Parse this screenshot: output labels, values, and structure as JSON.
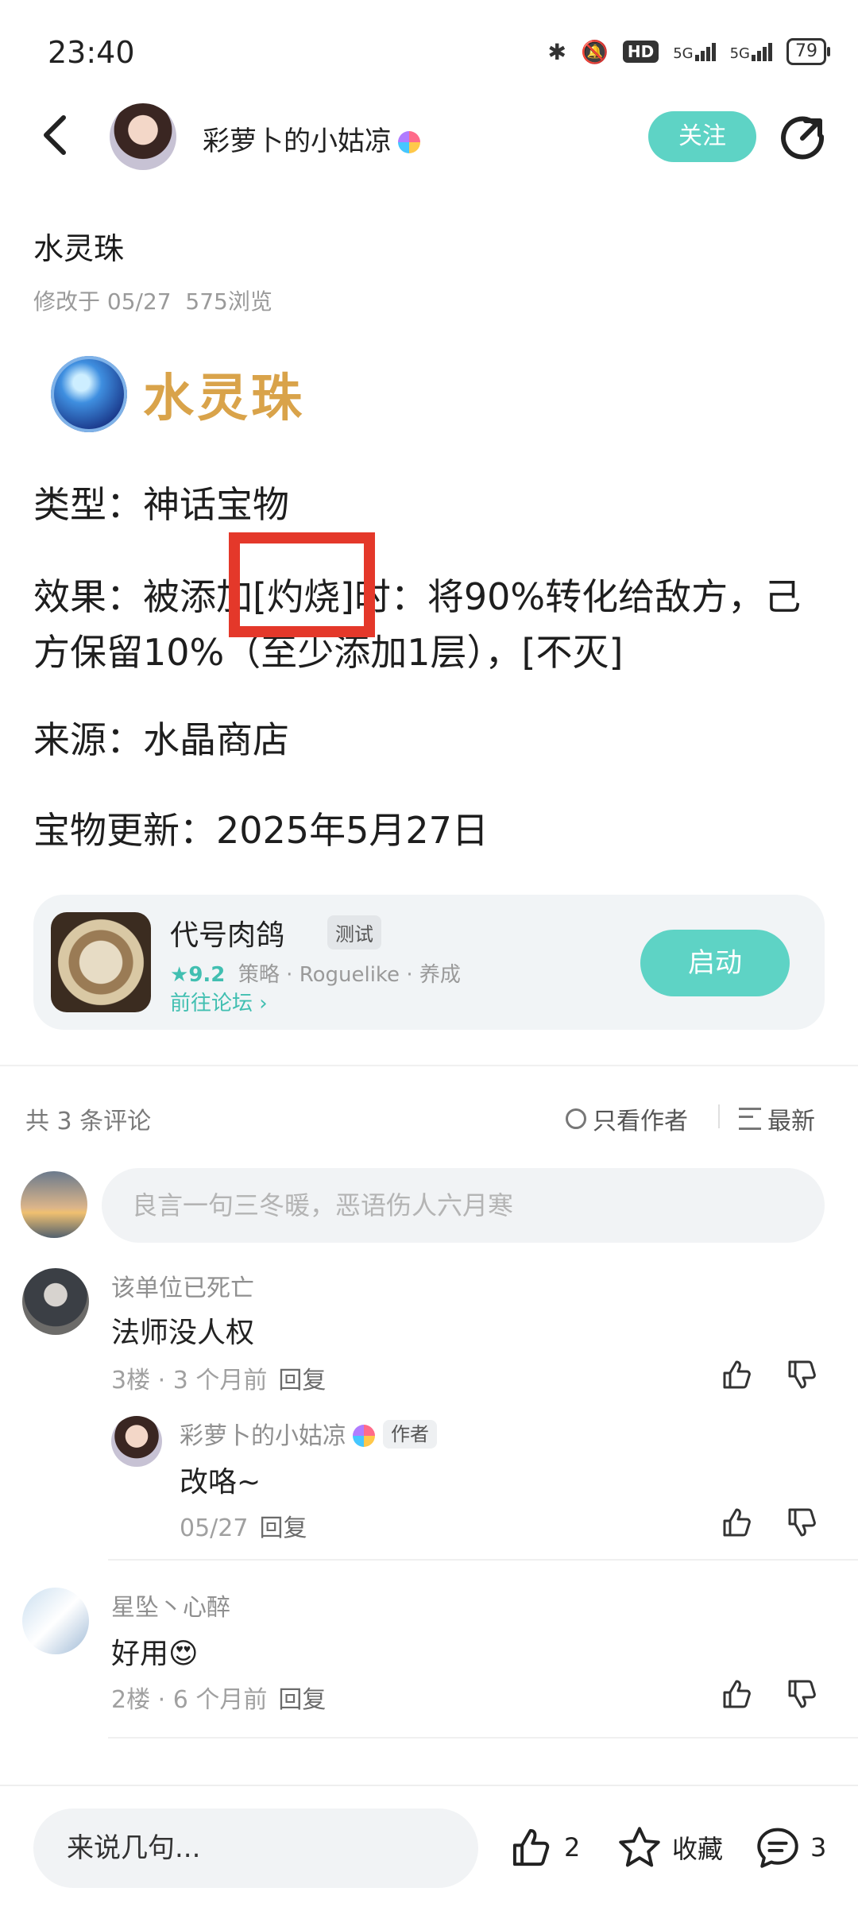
{
  "status": {
    "time": "23:40",
    "network": "5G",
    "network2": "5G",
    "hd": "HD",
    "battery": "79"
  },
  "header": {
    "author_name": "彩萝卜的小姑凉",
    "follow_label": "关注"
  },
  "article": {
    "title": "水灵珠",
    "modified": "修改于 05/27",
    "views": "575浏览",
    "banner_text": "水灵珠",
    "type_line": "类型：神话宝物",
    "effect_line": "效果：被添加[灼烧]时：将90%转化给敌方，己方保留10%（至少添加1层），[不灭]",
    "source_line": "来源：水晶商店",
    "update_line": "宝物更新：2025年5月27日"
  },
  "game_card": {
    "name": "代号肉鸽",
    "tag": "测试",
    "rating": "9.2",
    "genres": "策略 · Roguelike · 养成",
    "forum_link": "前往论坛",
    "launch_label": "启动"
  },
  "comments": {
    "count_label": "共 3 条评论",
    "only_author": "只看作者",
    "sort_label": "最新",
    "input_placeholder": "良言一句三冬暖，恶语伤人六月寒",
    "items": [
      {
        "name": "该单位已死亡",
        "text": "法师没人权",
        "meta": "3楼 · 3 个月前",
        "reply": "回复"
      },
      {
        "name": "彩萝卜的小姑凉",
        "author_tag": "作者",
        "text": "改咯~",
        "meta": "05/27",
        "reply": "回复"
      },
      {
        "name": "星坠丶心醉",
        "text": "好用😍",
        "meta": "2楼 · 6 个月前",
        "reply": "回复"
      }
    ]
  },
  "bottom_bar": {
    "input_placeholder": "来说几句...",
    "like_count": "2",
    "fav_label": "收藏",
    "comment_count": "3"
  }
}
